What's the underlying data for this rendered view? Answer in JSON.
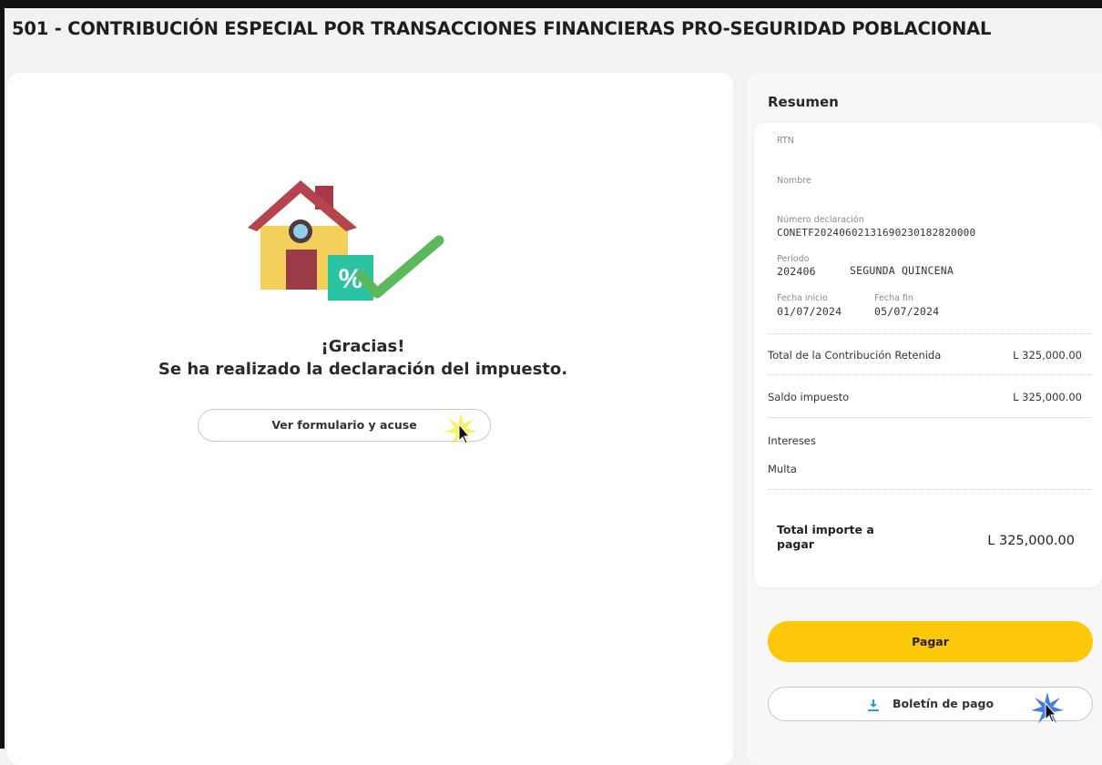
{
  "page": {
    "title": "501 - CONTRIBUCIÓN ESPECIAL POR TRANSACCIONES FINANCIERAS PRO-SEGURIDAD POBLACIONAL"
  },
  "confirmation": {
    "illustration": "house-percent-check-icon",
    "heading": "¡Gracias!",
    "message": "Se ha realizado la declaración del impuesto.",
    "view_form_button": "Ver formulario y acuse"
  },
  "summary": {
    "title": "Resumen",
    "rtn_label": "RTN",
    "rtn_value": "",
    "name_label": "Nombre",
    "name_value": "",
    "declaration_label": "Número declaración",
    "declaration_value": "CONETF20240602131690230182820000",
    "period_label": "Período",
    "period_value": "202406",
    "period_desc": "SEGUNDA QUINCENA",
    "start_label": "Fecha inicio",
    "start_value": "01/07/2024",
    "end_label": "Fecha fin",
    "end_value": "05/07/2024",
    "rows": [
      {
        "label": "Total de la Contribución Retenida",
        "value": "L 325,000.00"
      },
      {
        "label": "Saldo impuesto",
        "value": "L 325,000.00"
      },
      {
        "label": "Intereses",
        "value": ""
      },
      {
        "label": "Multa",
        "value": ""
      }
    ],
    "total_label": "Total importe a pagar",
    "total_value": "L 325,000.00"
  },
  "actions": {
    "pay_button": "Pagar",
    "voucher_button": "Boletín de pago",
    "voucher_icon": "download-icon"
  },
  "colors": {
    "accent": "#fdc80a",
    "check": "#5cb85c",
    "percent_tile": "#2bc4a3",
    "roof": "#b5444c",
    "house_wall": "#f3cf5c",
    "download_icon": "#2a9fd6"
  }
}
